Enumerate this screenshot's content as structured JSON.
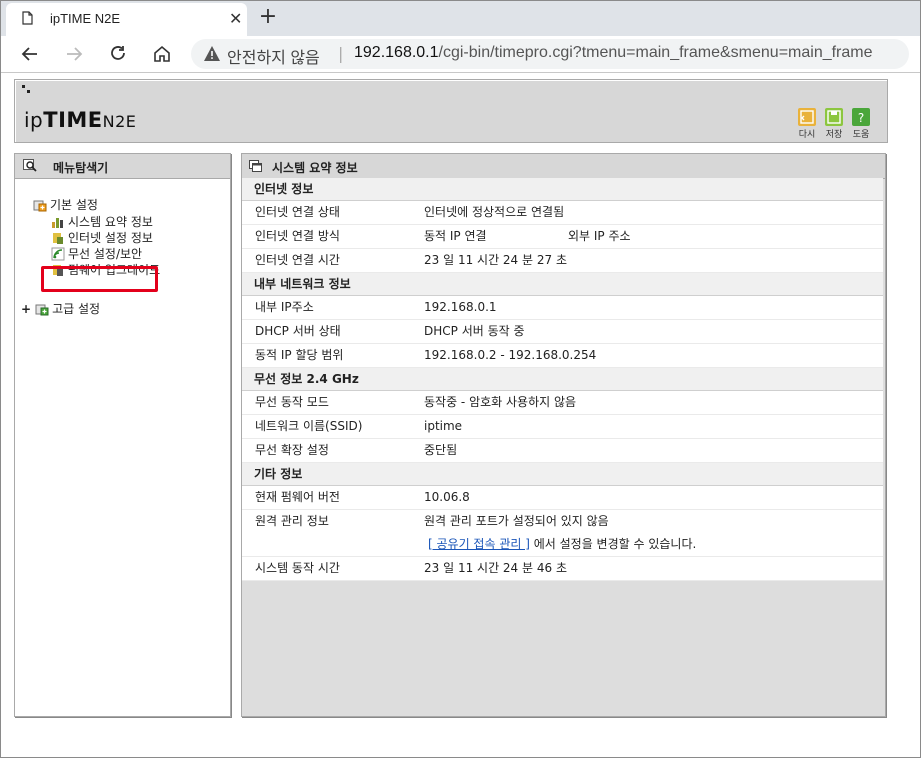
{
  "browser": {
    "tab_title": "ipTIME N2E",
    "close_tab": "✕",
    "new_tab": "+",
    "security_warning": "안전하지 않음",
    "address_separator": "|",
    "url_host": "192.168.0.1",
    "url_path": "/cgi-bin/timepro.cgi?tmenu=main_frame&smenu=main_frame",
    "nav_icons": [
      "back-icon",
      "forward-icon",
      "reload-icon",
      "home-icon"
    ]
  },
  "header": {
    "logo_ip": "ip",
    "logo_time": "TIME",
    "logo_model": "N2E",
    "buttons": [
      {
        "label": "다시",
        "color": "#e9b23b"
      },
      {
        "label": "저장",
        "color": "#8cc63f"
      },
      {
        "label": "도움",
        "color": "#4aa63a"
      }
    ]
  },
  "left_panel": {
    "title": "메뉴탐색기",
    "basic": "기본 설정",
    "basic_items": [
      "시스템 요약 정보",
      "인터넷 설정 정보",
      "무선 설정/보안",
      "펌웨어 업그레이드"
    ],
    "advanced_toggle": "+",
    "advanced": "고급 설정",
    "highlight_color": "#e3001b"
  },
  "right_panel": {
    "title": "시스템 요약 정보",
    "sections": {
      "internet": {
        "title": "인터넷 정보",
        "rows": [
          {
            "k": "인터넷 연결 상태",
            "v": "인터넷에 정상적으로 연결됨"
          },
          {
            "k": "인터넷 연결 방식",
            "v": "동적 IP 연결",
            "v2": "외부 IP 주소"
          },
          {
            "k": "인터넷 연결 시간",
            "v": "23 일 11 시간 24 분 27 초"
          }
        ]
      },
      "lan": {
        "title": "내부 네트워크 정보",
        "rows": [
          {
            "k": "내부 IP주소",
            "v": "192.168.0.1"
          },
          {
            "k": "DHCP 서버 상태",
            "v": "DHCP 서버 동작 중"
          },
          {
            "k": "동적 IP 할당 범위",
            "v": "192.168.0.2 -  192.168.0.254"
          }
        ]
      },
      "wireless": {
        "title": "무선 정보 2.4 GHz",
        "rows": [
          {
            "k": "무선 동작 모드",
            "v": "동작중 - 암호화 사용하지 않음"
          },
          {
            "k": "네트워크 이름(SSID)",
            "v": "iptime"
          },
          {
            "k": "무선 확장 설정",
            "v": "중단됨"
          }
        ]
      },
      "etc": {
        "title": "기타 정보",
        "firmware_k": "현재 펌웨어 버전",
        "firmware_v": "10.06.8",
        "remote_k": "원격 관리 정보",
        "remote_v": "원격 관리 포트가 설정되어 있지 않음",
        "remote_link": "[ 공유기 접속 관리 ]",
        "remote_link_suffix": " 에서 설정을 변경할 수 있습니다.",
        "uptime_k": "시스템 동작 시간",
        "uptime_v": "23 일 11 시간 24 분 46 초"
      }
    }
  }
}
